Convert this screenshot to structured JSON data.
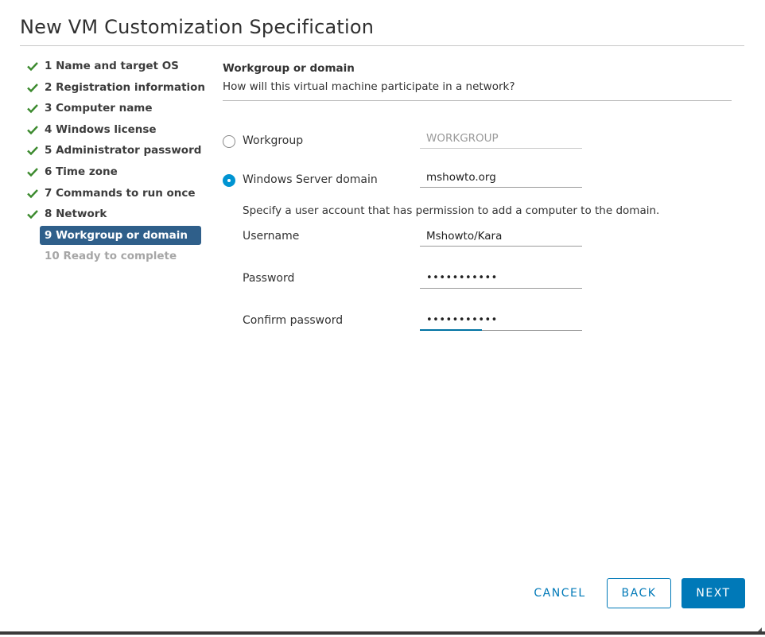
{
  "dialog": {
    "title": "New VM Customization Specification"
  },
  "steps": [
    {
      "label": "1 Name and target OS",
      "state": "done"
    },
    {
      "label": "2 Registration information",
      "state": "done"
    },
    {
      "label": "3 Computer name",
      "state": "done"
    },
    {
      "label": "4 Windows license",
      "state": "done"
    },
    {
      "label": "5 Administrator password",
      "state": "done"
    },
    {
      "label": "6 Time zone",
      "state": "done"
    },
    {
      "label": "7 Commands to run once",
      "state": "done"
    },
    {
      "label": "8 Network",
      "state": "done"
    },
    {
      "label": "9 Workgroup or domain",
      "state": "active"
    },
    {
      "label": "10 Ready to complete",
      "state": "disabled"
    }
  ],
  "section": {
    "title": "Workgroup or domain",
    "description": "How will this virtual machine participate in a network?"
  },
  "workgroup": {
    "label": "Workgroup",
    "value": "WORKGROUP",
    "selected": false
  },
  "domain": {
    "label": "Windows Server domain",
    "value": "mshowto.org",
    "selected": true,
    "hint": "Specify a user account that has permission to add a computer to the domain.",
    "username_label": "Username",
    "username_value": "Mshowto/Kara",
    "password_label": "Password",
    "password_value": "•••••••••••",
    "confirm_label": "Confirm password",
    "confirm_value": "•••••••••••"
  },
  "footer": {
    "cancel": "CANCEL",
    "back": "BACK",
    "next": "NEXT"
  },
  "colors": {
    "accent": "#0079b8",
    "active_step_bg": "#2f5f8a",
    "check": "#3c8a2e"
  },
  "icons": {
    "step_done": "check-icon",
    "resize": "resize-grip-icon"
  }
}
